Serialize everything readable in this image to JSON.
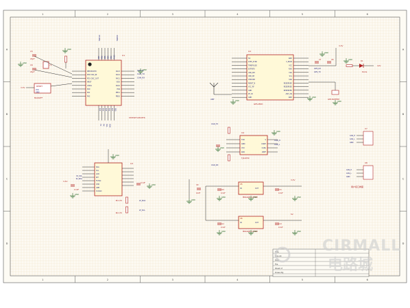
{
  "sheet": {
    "columns": [
      "1",
      "2",
      "3",
      "4",
      "5",
      "6"
    ],
    "rows": [
      "A",
      "B",
      "C",
      "D"
    ],
    "paper_color": "#fdfbf4",
    "grid_color": "#f0e3c6",
    "border_color": "#555555",
    "wire_color": "#2b2b2b",
    "part_color": "#b02020",
    "label_color": "#1f1f7a",
    "gnd_color": "#2a6a2a"
  },
  "mcu": {
    "ref": "U1",
    "part": "STM32F103C8T6",
    "left_pins": [
      "PB8 BOOT0",
      "PD0 OSC_IN",
      "PD1 OSC_OUT",
      "NRST",
      "VDDA",
      "PA0",
      "PA1",
      "PA2"
    ],
    "right_pins": [
      "PA13",
      "PA12",
      "PA11",
      "VDD",
      "PA10",
      "PA9",
      "PB11",
      "PB10"
    ],
    "top_pins": [
      "PB7",
      "PB6",
      "PB5",
      "PB4",
      "PB3",
      "PA15"
    ],
    "bottom_pins": [
      "PA3",
      "PA4",
      "PA5",
      "PA6",
      "PA7",
      "PB0"
    ],
    "nets_top": [
      "SWCLK",
      "SWDIO"
    ],
    "nets_right": [
      "SWDIO",
      "CAN_TX",
      "CAN_RX"
    ],
    "nets_bottom": [
      "TX",
      "RX",
      "SCL",
      "SDA"
    ]
  },
  "crystal": {
    "ref": "Y1",
    "cap1": "C5",
    "cap2": "C6",
    "val": "22pF"
  },
  "reset": {
    "ref": "RESET",
    "label": "MA0A0FF",
    "pins": [
      "VCC",
      "GND"
    ]
  },
  "gps": {
    "ref": "U2",
    "part": "GPS-MOD",
    "left_pins": [
      "NC",
      "1PPS_SYNC",
      "TIMEPULSE",
      "EXTINT0",
      "USB_DM",
      "USB_DP",
      "VDDUSB",
      "RESET_N",
      "VCC_RF",
      "GND",
      "RF_IN",
      "GND"
    ],
    "right_pins": [
      "GND",
      "V_BCKP",
      "VCC",
      "RXD",
      "TXD",
      "SCL",
      "SDA",
      "RESERVED",
      "RESERVED",
      "RESERVED",
      "ANT_ON",
      "GND"
    ],
    "nets": [
      "GPS_RX",
      "GPS_TX"
    ],
    "battery": "GPS BATTERY",
    "antenna": "ANT"
  },
  "power_net": {
    "v33": "3.3V",
    "v5": "5V",
    "v12": "12V",
    "gnd": "GND"
  },
  "diode": {
    "ref": "D1",
    "label": "Diode"
  },
  "can": {
    "ref": "U4",
    "part": "TJA1050",
    "left_pins": [
      "TXD",
      "GND",
      "VCC",
      "RXD"
    ],
    "right_pins": [
      "S",
      "CANH",
      "CANL",
      "VREF"
    ],
    "nets": [
      "CAN_TX",
      "CAN_RX",
      "CAN_H",
      "CAN_L"
    ]
  },
  "conn": {
    "ref1": "U7",
    "ref2": "U8",
    "label": "用户接口排座",
    "pins": [
      "CAN_H",
      "CAN_L",
      "GND"
    ]
  },
  "imu": {
    "ref": "U3",
    "left_pins": [
      "SDA",
      "SCL",
      "AD0",
      "INT",
      "FSYNC",
      "VDD",
      "GND",
      "VLOGIC"
    ],
    "nets": [
      "W_SDA",
      "W_SCL"
    ],
    "r1": "R5 4.7K",
    "r2": "R6 4.7K",
    "cap": "0.1UF"
  },
  "regulators": [
    {
      "ref": "U5",
      "part": "MRA0AM_125NM",
      "in": "IN",
      "out": "OUT",
      "cin": "C10",
      "cout": "C11",
      "cval": "0.1UF",
      "vout": "3.3V"
    },
    {
      "ref": "U6",
      "part": "MRA0AM_125NM",
      "in": "IN",
      "out": "OUT",
      "cin": "C12",
      "cout": "C13",
      "cval": "0.1UF",
      "vout": "5V"
    }
  ],
  "bulk_cap": {
    "ref": "C9",
    "val": "10UF"
  },
  "title_block": {
    "rows": [
      "Title",
      "Size A4",
      "Date",
      "File",
      "Sheet of",
      "Drawn By"
    ]
  },
  "watermark": {
    "brand": "CIRMALL",
    "sub": "电路城"
  }
}
